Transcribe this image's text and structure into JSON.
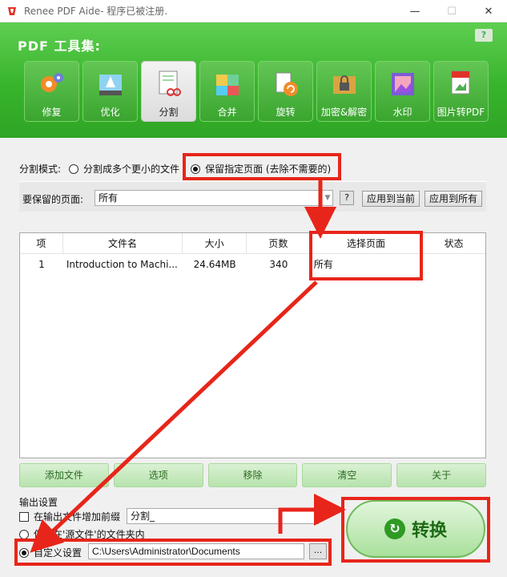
{
  "window": {
    "title": "Renee PDF Aide- 程序已被注册.",
    "minimize_icon": "minimize-icon",
    "maximize_icon": "maximize-icon",
    "close_icon": "close-icon"
  },
  "header": {
    "title": "PDF 工具集:",
    "help_icon": "help-bubble-icon",
    "tools": [
      {
        "label": "修复",
        "icon": "repair-gears-icon",
        "active": false
      },
      {
        "label": "优化",
        "icon": "optimize-rocket-icon",
        "active": false
      },
      {
        "label": "分割",
        "icon": "split-scissors-icon",
        "active": true
      },
      {
        "label": "合并",
        "icon": "merge-puzzle-icon",
        "active": false
      },
      {
        "label": "旋转",
        "icon": "rotate-icon",
        "active": false
      },
      {
        "label": "加密&解密",
        "icon": "lock-folder-icon",
        "active": false
      },
      {
        "label": "水印",
        "icon": "watermark-icon",
        "active": false
      },
      {
        "label": "图片转PDF",
        "icon": "image-to-pdf-icon",
        "active": false
      }
    ]
  },
  "split": {
    "mode_label": "分割模式:",
    "option_small_files": "分割成多个更小的文件",
    "option_keep_pages": "保留指定页面 (去除不需要的)",
    "selected_option": "keep_pages",
    "pages_label": "要保留的页面:",
    "pages_value": "所有",
    "help_label": "?",
    "apply_current_label": "应用到当前",
    "apply_all_label": "应用到所有"
  },
  "table": {
    "headers": [
      "项",
      "文件名",
      "大小",
      "页数",
      "选择页面",
      "状态"
    ],
    "rows": [
      {
        "index": "1",
        "file_name": "Introduction to Machi...",
        "size": "24.64MB",
        "pages": "340",
        "selected_pages": "所有",
        "status": ""
      }
    ]
  },
  "actions": {
    "add_file": "添加文件",
    "options": "选项",
    "remove": "移除",
    "clear": "清空",
    "about": "关于"
  },
  "output": {
    "title": "输出设置",
    "prefix_checkbox_label": "在输出文件增加前缀",
    "prefix_value": "分割_",
    "save_source_label": "保存在'源文件'的文件夹内",
    "custom_label": "自定义设置",
    "custom_path": "C:\\Users\\Administrator\\Documents",
    "browse_label": "...",
    "selected": "custom"
  },
  "convert": {
    "label": "转换",
    "icon": "refresh-circle-icon"
  },
  "colors": {
    "header_green": "#38b42c",
    "annotation_red": "#e8251a",
    "convert_text": "#1e6a16"
  }
}
